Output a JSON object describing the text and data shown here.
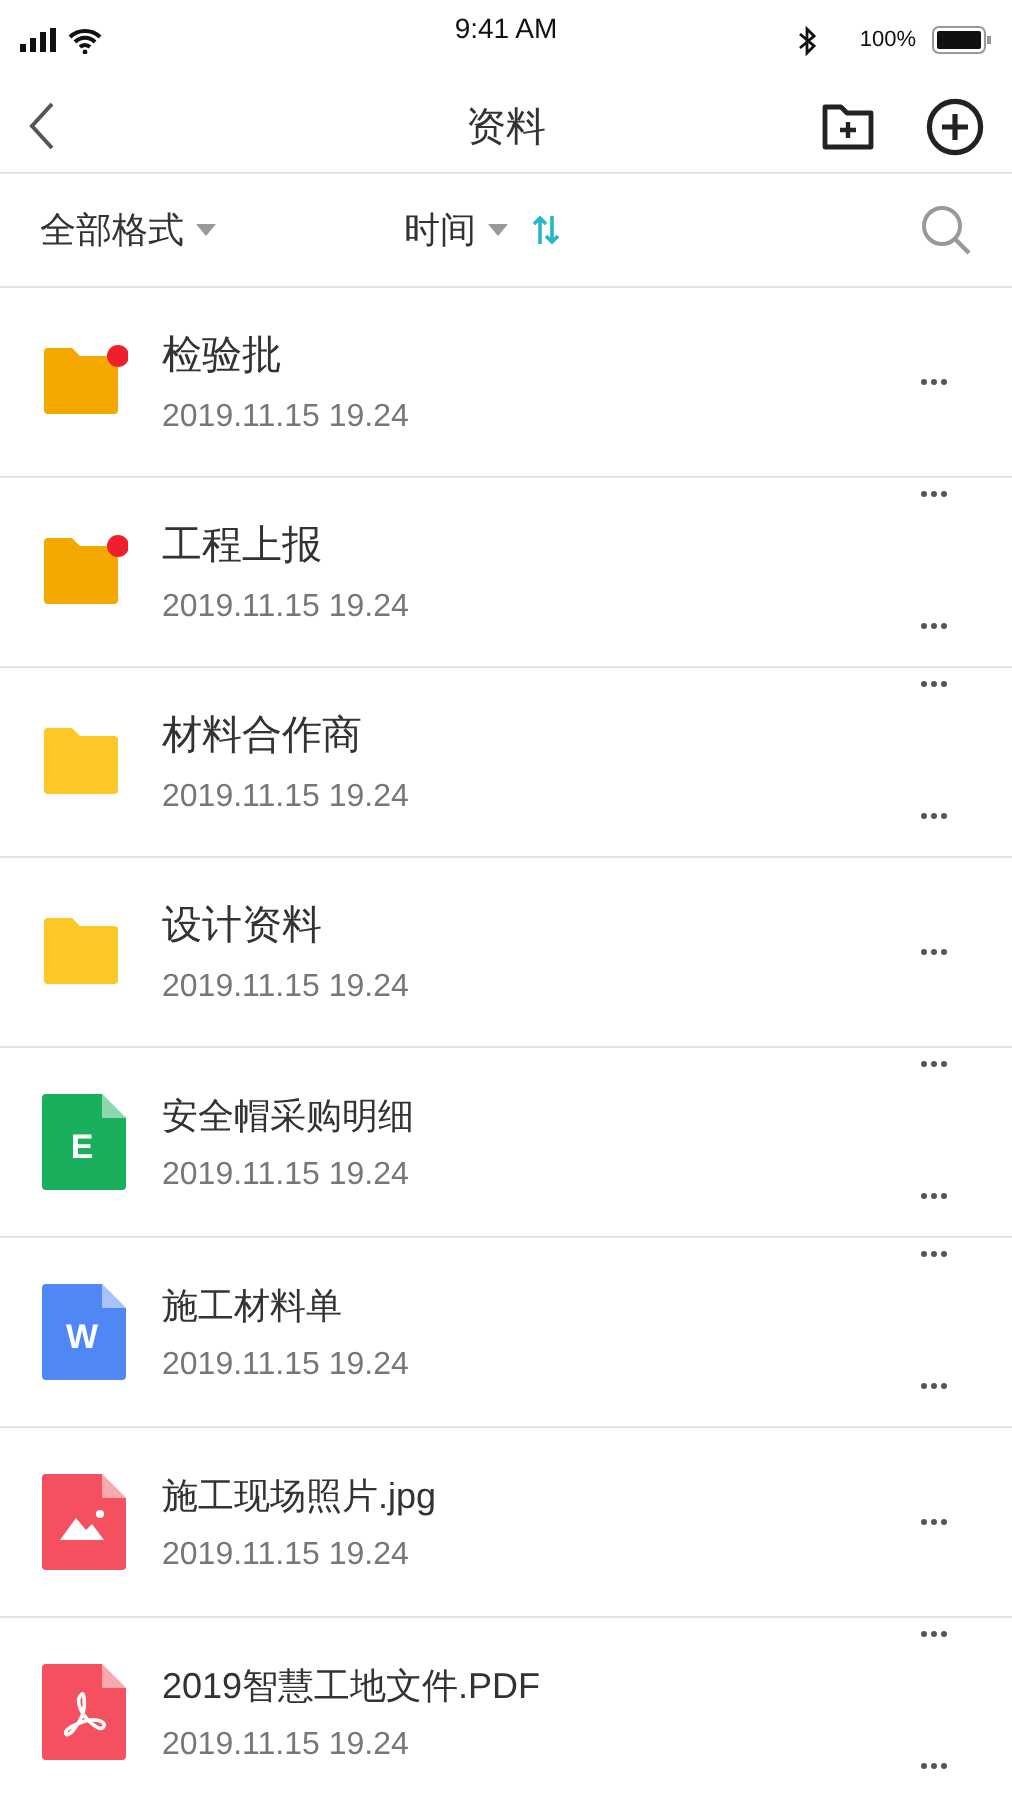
{
  "status_bar": {
    "time": "9:41 AM",
    "battery": "100%"
  },
  "header": {
    "title": "资料"
  },
  "filters": {
    "format": "全部格式",
    "sort": "时间"
  },
  "files": [
    {
      "kind": "folder",
      "color": "#f5a800",
      "unread": true,
      "name": "检验批",
      "date": "2019.11.15 19.24",
      "split_menu": false
    },
    {
      "kind": "folder",
      "color": "#f5a800",
      "unread": true,
      "name": "工程上报",
      "date": "2019.11.15 19.24",
      "split_menu": true
    },
    {
      "kind": "folder",
      "color": "#fdc727",
      "unread": false,
      "name": "材料合作商",
      "date": "2019.11.15 19.24",
      "split_menu": true
    },
    {
      "kind": "folder",
      "color": "#fdc727",
      "unread": false,
      "name": "设计资料",
      "date": "2019.11.15 19.24",
      "split_menu": false
    },
    {
      "kind": "sheet",
      "color": "#1aaf5d",
      "unread": false,
      "badge": "E",
      "name": "安全帽采购明细",
      "date": "2019.11.15 19.24",
      "split_menu": true
    },
    {
      "kind": "doc",
      "color": "#4f87f5",
      "unread": false,
      "badge": "W",
      "name": "施工材料单",
      "date": "2019.11.15 19.24",
      "split_menu": true
    },
    {
      "kind": "image",
      "color": "#f5505f",
      "unread": false,
      "name": "施工现场照片.jpg",
      "date": "2019.11.15 19.24",
      "split_menu": false
    },
    {
      "kind": "pdf",
      "color": "#f5505f",
      "unread": false,
      "name": "2019智慧工地文件.PDF",
      "date": "2019.11.15 19.24",
      "split_menu": true
    }
  ]
}
